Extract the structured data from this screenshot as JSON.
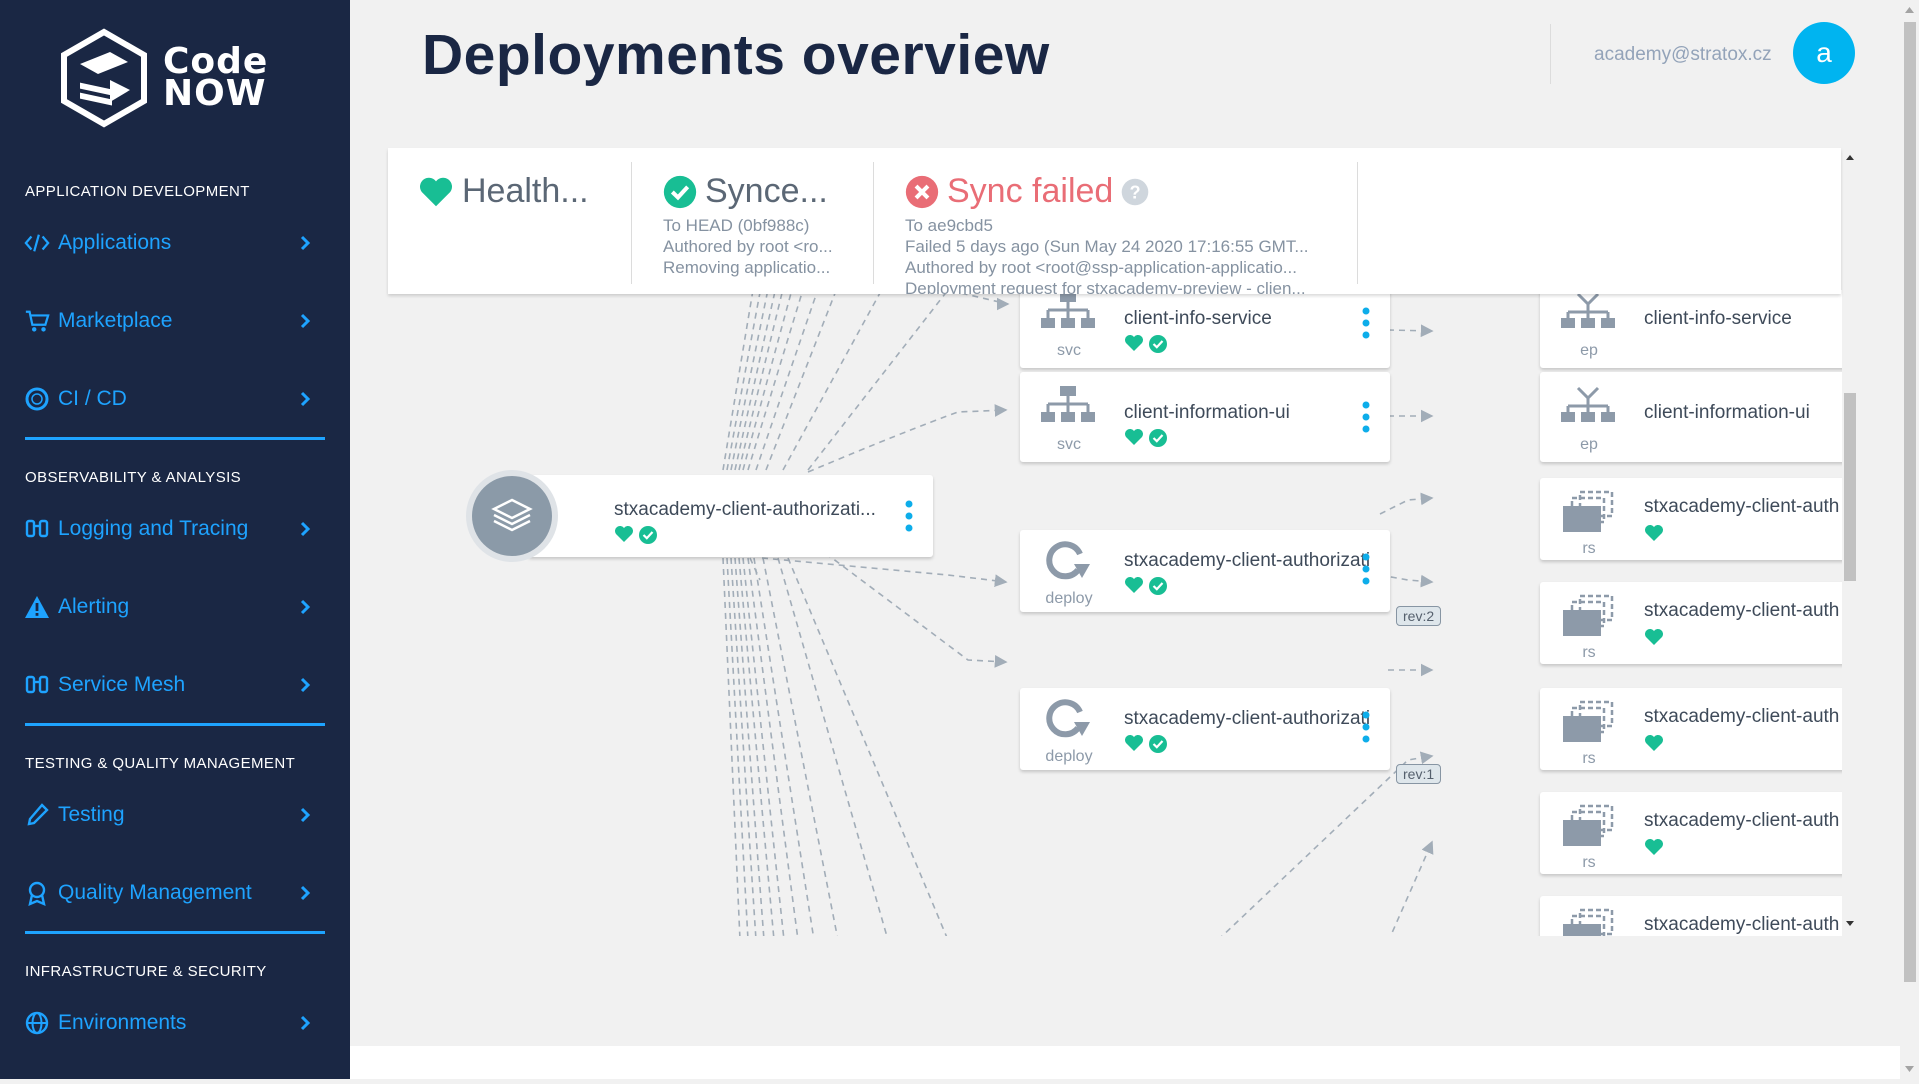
{
  "sidebar": {
    "logo_text_line1": "Code",
    "logo_text_line2": "NOW",
    "sections": [
      {
        "title": "APPLICATION DEVELOPMENT",
        "items": [
          {
            "label": "Applications",
            "icon": "code-icon"
          },
          {
            "label": "Marketplace",
            "icon": "cart-icon"
          },
          {
            "label": "CI / CD",
            "icon": "circle-icon"
          }
        ]
      },
      {
        "title": "OBSERVABILITY & ANALYSIS",
        "items": [
          {
            "label": "Logging and Tracing",
            "icon": "binoculars-icon"
          },
          {
            "label": "Alerting",
            "icon": "warning-icon"
          },
          {
            "label": "Service Mesh",
            "icon": "binoculars-icon"
          }
        ]
      },
      {
        "title": "TESTING & QUALITY MANAGEMENT",
        "items": [
          {
            "label": "Testing",
            "icon": "pipette-icon"
          },
          {
            "label": "Quality Management",
            "icon": "badge-icon"
          }
        ]
      },
      {
        "title": "INFRASTRUCTURE & SECURITY",
        "items": [
          {
            "label": "Environments",
            "icon": "globe-icon"
          }
        ]
      }
    ]
  },
  "header": {
    "title": "Deployments overview",
    "user_email": "academy@stratox.cz",
    "avatar_letter": "a"
  },
  "status": {
    "health": {
      "label": "Health..."
    },
    "sync": {
      "label": "Synce...",
      "lines": [
        "To HEAD (0bf988c)",
        "Authored by root <ro...",
        "Removing applicatio..."
      ]
    },
    "operation": {
      "label": "Sync failed",
      "lines": [
        "To ae9cbd5",
        "Failed 5 days ago (Sun May 24 2020 17:16:55 GMT...",
        "Authored by root <root@ssp-application-applicatio...",
        "Deployment request for stxacademy-preview - clien..."
      ]
    }
  },
  "graph": {
    "app_node": {
      "label": "stxacademy-client-authorizati..."
    },
    "nodes": [
      {
        "kind": "svc",
        "label": "client-info-service"
      },
      {
        "kind": "ep",
        "label": "client-info-service"
      },
      {
        "kind": "svc",
        "label": "client-information-ui"
      },
      {
        "kind": "ep",
        "label": "client-information-ui"
      },
      {
        "kind": "deploy",
        "label": "stxacademy-client-authorizati...",
        "rev": "rev:2"
      },
      {
        "kind": "deploy",
        "label": "stxacademy-client-authorizati...",
        "rev": "rev:1"
      },
      {
        "kind": "rs",
        "label": "stxacademy-client-auth"
      },
      {
        "kind": "rs",
        "label": "stxacademy-client-auth"
      },
      {
        "kind": "rs",
        "label": "stxacademy-client-auth"
      },
      {
        "kind": "rs",
        "label": "stxacademy-client-auth"
      },
      {
        "kind": "rs",
        "label": "stxacademy-client-auth"
      }
    ]
  },
  "colors": {
    "sidebar_bg": "#1a2744",
    "accent": "#1ea3ff",
    "healthy": "#18be94",
    "failed": "#e96d76",
    "avatar": "#00b4f0"
  }
}
